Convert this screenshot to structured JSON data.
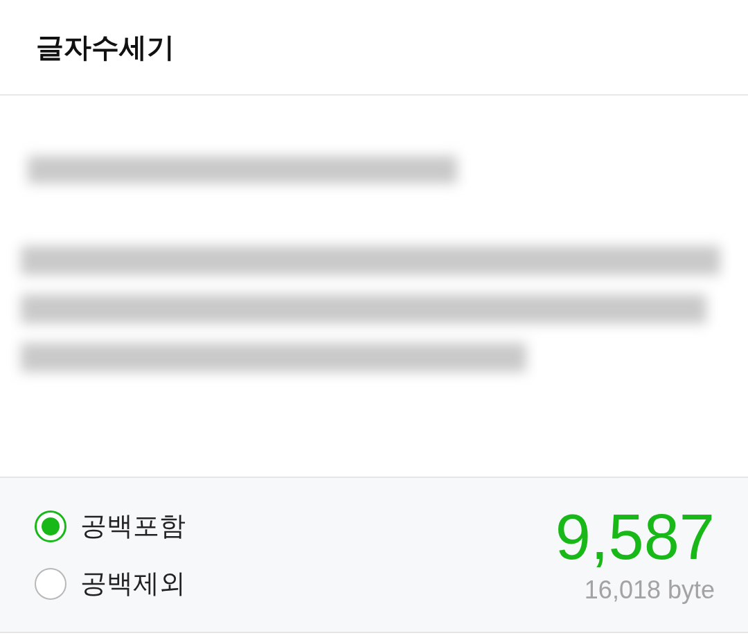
{
  "title": "글자수세기",
  "options": [
    {
      "label": "공백포함",
      "selected": true
    },
    {
      "label": "공백제외",
      "selected": false
    }
  ],
  "count": "9,587",
  "bytes": "16,018 byte"
}
